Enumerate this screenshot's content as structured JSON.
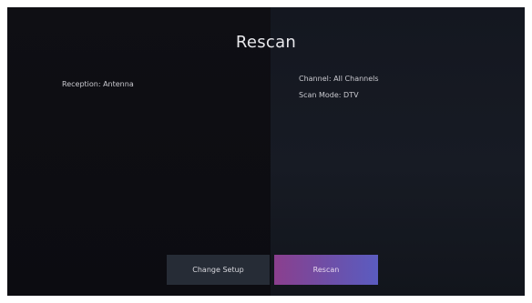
{
  "page": {
    "title": "Rescan"
  },
  "settings": {
    "reception": "Reception: Antenna",
    "channel": "Channel: All Channels",
    "scan_mode": "Scan Mode: DTV"
  },
  "buttons": {
    "change_setup": "Change Setup",
    "rescan": "Rescan"
  },
  "colors": {
    "background": "#0d0d12",
    "right_panel": "#171b24",
    "secondary_button": "#262c36",
    "accent_start": "#8b3f8e",
    "accent_end": "#5b5cc0"
  }
}
